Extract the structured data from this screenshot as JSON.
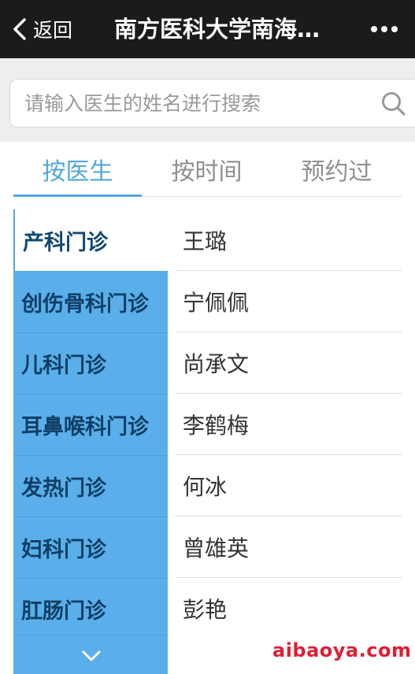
{
  "header": {
    "back_label": "返回",
    "title": "南方医科大学南海…",
    "more_icon": "more-dots-icon"
  },
  "search": {
    "placeholder": "请输入医生的姓名进行搜索",
    "value": "",
    "icon": "search-icon"
  },
  "tabs": [
    {
      "label": "按医生",
      "active": true
    },
    {
      "label": "按时间",
      "active": false
    },
    {
      "label": "预约过",
      "active": false
    }
  ],
  "departments": [
    {
      "label": "产科门诊",
      "selected": true
    },
    {
      "label": "创伤骨科门诊",
      "selected": false
    },
    {
      "label": "儿科门诊",
      "selected": false
    },
    {
      "label": "耳鼻喉科门诊",
      "selected": false
    },
    {
      "label": "发热门诊",
      "selected": false
    },
    {
      "label": "妇科门诊",
      "selected": false
    },
    {
      "label": "肛肠门诊",
      "selected": false
    }
  ],
  "doctors": [
    "王璐",
    "宁佩佩",
    "尚承文",
    "李鹤梅",
    "何冰",
    "曾雄英",
    "彭艳"
  ],
  "watermark": "aibaoya.com",
  "colors": {
    "accent": "#52a6df",
    "dept_bg": "#5aafea",
    "dept_text": "#0f3f66",
    "topbar": "#1b1b1b",
    "watermark": "#e11d33"
  }
}
